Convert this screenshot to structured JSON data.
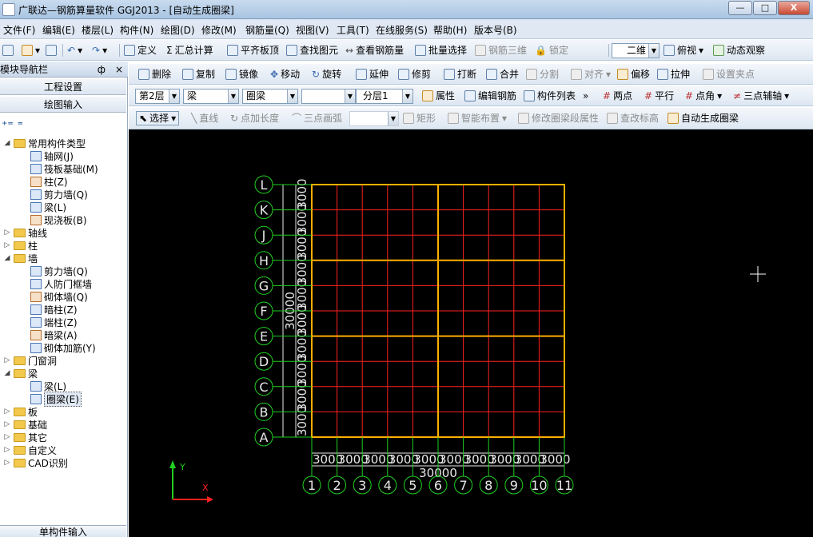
{
  "window": {
    "title": "广联达—钢筋算量软件 GGJ2013 - [自动生成圈梁]",
    "minimize": "—",
    "restore": "□",
    "close": "X"
  },
  "menubar": {
    "items": [
      "文件(F)",
      "编辑(E)",
      "楼层(L)",
      "构件(N)",
      "绘图(D)",
      "修改(M)",
      "钢筋量(Q)",
      "视图(V)",
      "工具(T)",
      "在线服务(S)",
      "帮助(H)",
      "版本号(B)"
    ]
  },
  "toolbar1": {
    "define": "定义",
    "sum_calc": "汇总计算",
    "align_slab_top": "平齐板顶",
    "find_element": "查找图元",
    "view_rebar_qty": "查看钢筋量",
    "batch_select": "批量选择",
    "rebar_3d": "钢筋三维",
    "lock": "锁定",
    "view_mode": "二维",
    "top_view": "俯视",
    "dynamic_observe": "动态观察"
  },
  "toolbar2": {
    "delete": "删除",
    "copy": "复制",
    "mirror": "镜像",
    "move": "移动",
    "rotate": "旋转",
    "extend": "延伸",
    "trim": "修剪",
    "break": "打断",
    "merge": "合并",
    "split": "分割",
    "align": "对齐",
    "offset": "偏移",
    "stretch": "拉伸",
    "set_grip": "设置夹点"
  },
  "toolbar3": {
    "floor": "第2层",
    "category": "梁",
    "type": "圈梁",
    "element": "",
    "layer": "分层1",
    "properties": "属性",
    "edit_rebar": "编辑钢筋",
    "element_list": "构件列表",
    "two_points": "两点",
    "parallel": "平行",
    "point_angle": "点角",
    "three_point_aux": "三点辅轴"
  },
  "toolbar4": {
    "select": "选择",
    "line": "直线",
    "point_length": "点加长度",
    "three_point_arc": "三点画弧",
    "rectangle": "矩形",
    "smart_layout": "智能布置",
    "modify_segment_props": "修改圈梁段属性",
    "view_elevation": "查改标高",
    "auto_generate": "自动生成圈梁"
  },
  "nav": {
    "title": "模块导航栏",
    "pin": "ф",
    "close": "×",
    "project_settings": "工程设置",
    "drawing_input": "绘图输入",
    "single_input": "单构件输入",
    "tree": [
      {
        "label": "常用构件类型",
        "kind": "folder",
        "expanded": true,
        "level": 0
      },
      {
        "label": "轴网(J)",
        "kind": "item",
        "level": 1
      },
      {
        "label": "筏板基础(M)",
        "kind": "item",
        "level": 1
      },
      {
        "label": "柱(Z)",
        "kind": "item",
        "level": 1
      },
      {
        "label": "剪力墙(Q)",
        "kind": "item",
        "level": 1
      },
      {
        "label": "梁(L)",
        "kind": "item",
        "level": 1
      },
      {
        "label": "现浇板(B)",
        "kind": "item",
        "level": 1
      },
      {
        "label": "轴线",
        "kind": "folder",
        "expanded": false,
        "level": 0
      },
      {
        "label": "柱",
        "kind": "folder",
        "expanded": false,
        "level": 0
      },
      {
        "label": "墙",
        "kind": "folder",
        "expanded": true,
        "level": 0
      },
      {
        "label": "剪力墙(Q)",
        "kind": "item",
        "level": 1
      },
      {
        "label": "人防门框墙",
        "kind": "item",
        "level": 1
      },
      {
        "label": "砌体墙(Q)",
        "kind": "item",
        "level": 1
      },
      {
        "label": "暗柱(Z)",
        "kind": "item",
        "level": 1
      },
      {
        "label": "端柱(Z)",
        "kind": "item",
        "level": 1
      },
      {
        "label": "暗梁(A)",
        "kind": "item",
        "level": 1
      },
      {
        "label": "砌体加筋(Y)",
        "kind": "item",
        "level": 1
      },
      {
        "label": "门窗洞",
        "kind": "folder",
        "expanded": false,
        "level": 0
      },
      {
        "label": "梁",
        "kind": "folder",
        "expanded": true,
        "level": 0
      },
      {
        "label": "梁(L)",
        "kind": "item",
        "level": 1
      },
      {
        "label": "圈梁(E)",
        "kind": "item",
        "level": 1,
        "selected": true
      },
      {
        "label": "板",
        "kind": "folder",
        "expanded": false,
        "level": 0
      },
      {
        "label": "基础",
        "kind": "folder",
        "expanded": false,
        "level": 0
      },
      {
        "label": "其它",
        "kind": "folder",
        "expanded": false,
        "level": 0
      },
      {
        "label": "自定义",
        "kind": "folder",
        "expanded": false,
        "level": 0
      },
      {
        "label": "CAD识别",
        "kind": "folder",
        "expanded": false,
        "level": 0
      }
    ]
  },
  "drawing": {
    "row_axes": [
      "A",
      "B",
      "C",
      "D",
      "E",
      "F",
      "G",
      "H",
      "J",
      "K",
      "L"
    ],
    "col_axes": [
      "1",
      "2",
      "3",
      "4",
      "5",
      "6",
      "7",
      "8",
      "9",
      "10",
      "11"
    ],
    "spacing_label": "3000",
    "total_label": "30000",
    "ucs_y": "Y",
    "ucs_x": "X",
    "colors": {
      "background": "#000000",
      "grid": "#ff2020",
      "beam": "#ffb000",
      "axis": "#20d020",
      "dimension": "#e8e8e8"
    }
  }
}
